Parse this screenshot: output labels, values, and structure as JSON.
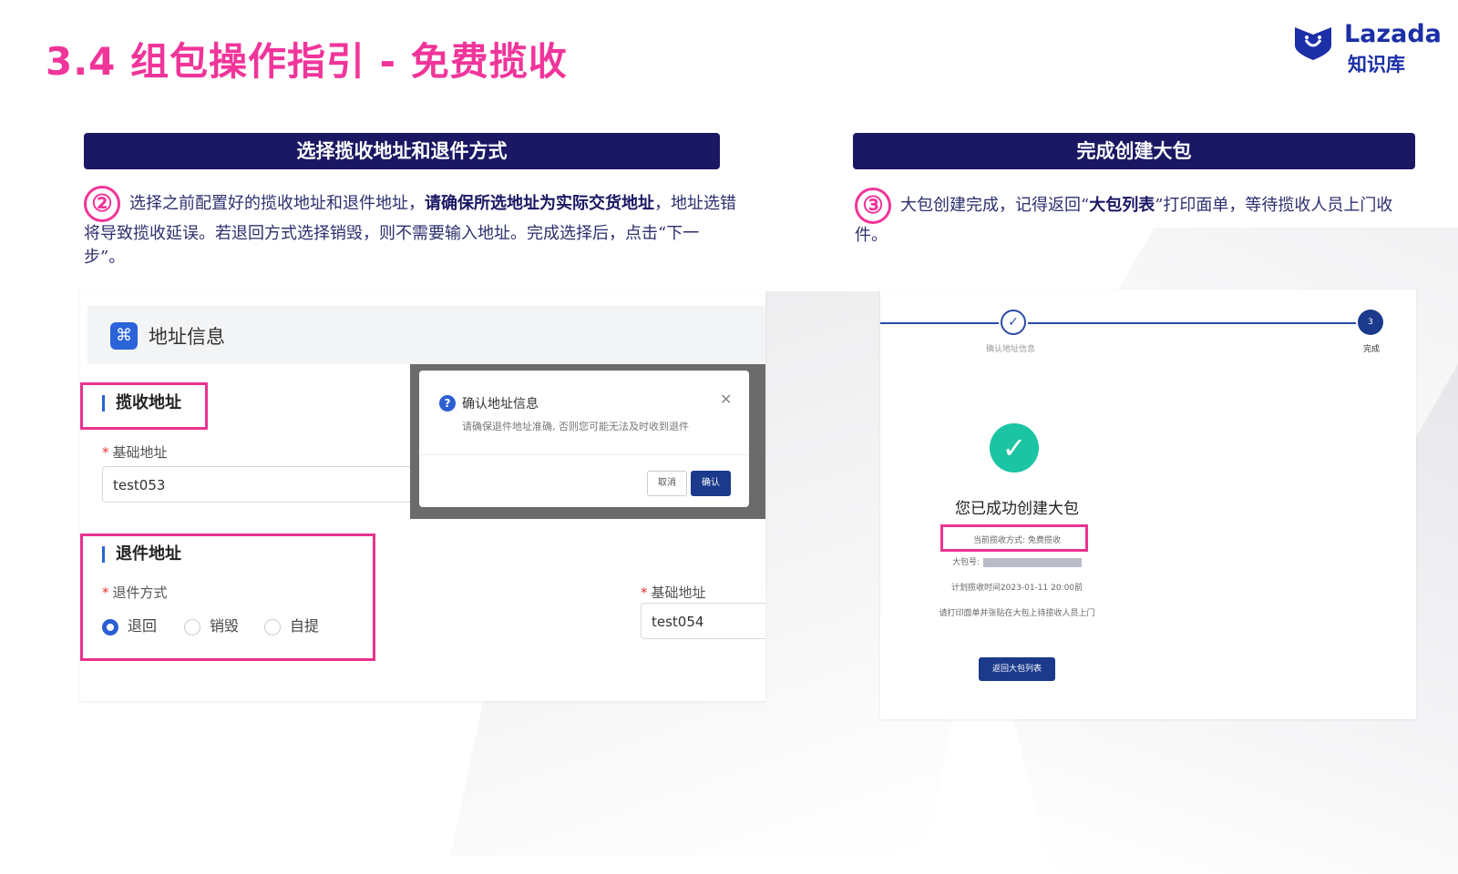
{
  "page_title": "3.4 组包操作指引 - 免费揽收",
  "logo": {
    "name": "Lazada",
    "sub": "知识库",
    "color": "#1b2fa6"
  },
  "accent_pink": "#f0359a",
  "left": {
    "banner": "选择揽收地址和退件方式",
    "step_num": "②",
    "desc_pre": "选择之前配置好的揽收地址和退件地址，",
    "desc_bold": "请确保所选地址为实际交货地址",
    "desc_post": "，地址选错将导致揽收延误。若退回方式选择销毁，则不需要输入地址。完成选择后，点击“下一步”。",
    "panel_title": "地址信息",
    "pickup_section": "揽收地址",
    "pickup_field_label": "基础地址",
    "pickup_value": "test053",
    "return_section": "退件地址",
    "return_method_label": "退件方式",
    "return_options": [
      "退回",
      "销毁",
      "自提"
    ],
    "return_selected": "退回",
    "return_field_label": "基础地址",
    "return_value": "test054",
    "modal": {
      "title": "确认地址信息",
      "body": "请确保退件地址准确, 否则您可能无法及时收到退件",
      "cancel": "取消",
      "confirm": "确认"
    }
  },
  "right": {
    "banner": "完成创建大包",
    "step_num": "③",
    "desc_pre": "大包创建完成，记得返回“",
    "desc_bold": "大包列表",
    "desc_post": "”打印面单，等待揽收人员上门收件。",
    "steps": [
      {
        "label": "确认地址信息"
      },
      {
        "num": "3",
        "label": "完成"
      }
    ],
    "success_title": "您已成功创建大包",
    "pickup_method": "当前揽收方式: 免费揽收",
    "package_no_label": "大包号:",
    "schedule": "计划揽收时间2023-01-11 20:00前",
    "instruction": "请打印面单并张贴在大包上待揽收人员上门",
    "back_button": "返回大包列表"
  }
}
